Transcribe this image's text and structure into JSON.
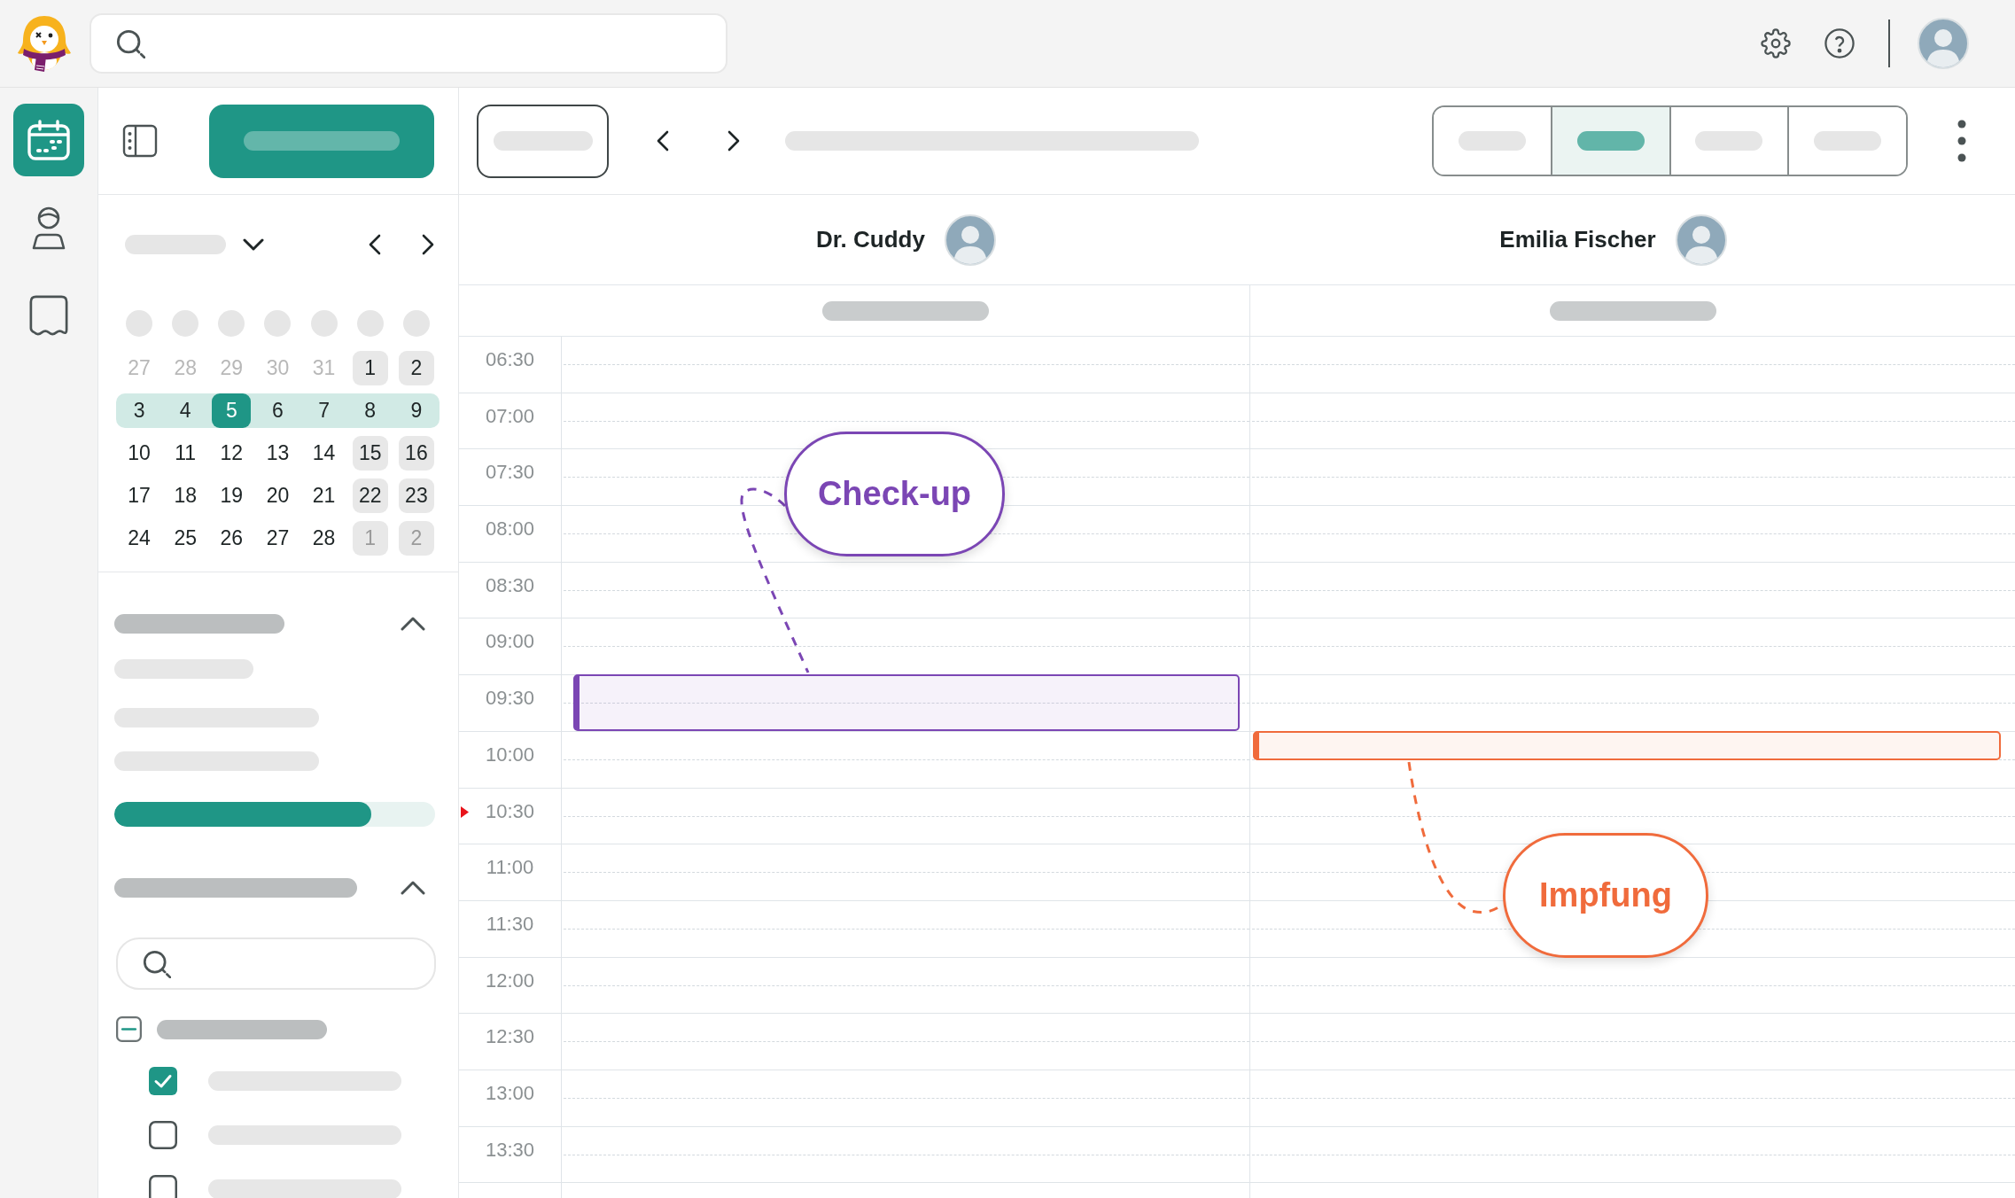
{
  "nav_rail": [
    {
      "selected": true
    },
    {
      "selected": false
    },
    {
      "selected": false
    }
  ],
  "mini_calendar": {
    "weeks": [
      {
        "selected": false,
        "days": [
          {
            "label": "27",
            "outside": true,
            "shaded": false,
            "selected": false
          },
          {
            "label": "28",
            "outside": true,
            "shaded": false,
            "selected": false
          },
          {
            "label": "29",
            "outside": true,
            "shaded": false,
            "selected": false
          },
          {
            "label": "30",
            "outside": true,
            "shaded": false,
            "selected": false
          },
          {
            "label": "31",
            "outside": true,
            "shaded": false,
            "selected": false
          },
          {
            "label": "1",
            "outside": false,
            "shaded": true,
            "selected": false
          },
          {
            "label": "2",
            "outside": false,
            "shaded": true,
            "selected": false
          }
        ]
      },
      {
        "selected": true,
        "days": [
          {
            "label": "3",
            "outside": false,
            "shaded": false,
            "selected": false
          },
          {
            "label": "4",
            "outside": false,
            "shaded": false,
            "selected": false
          },
          {
            "label": "5",
            "outside": false,
            "shaded": false,
            "selected": true
          },
          {
            "label": "6",
            "outside": false,
            "shaded": false,
            "selected": false
          },
          {
            "label": "7",
            "outside": false,
            "shaded": false,
            "selected": false
          },
          {
            "label": "8",
            "outside": false,
            "shaded": false,
            "selected": false
          },
          {
            "label": "9",
            "outside": false,
            "shaded": false,
            "selected": false
          }
        ]
      },
      {
        "selected": false,
        "days": [
          {
            "label": "10",
            "outside": false,
            "shaded": false,
            "selected": false
          },
          {
            "label": "11",
            "outside": false,
            "shaded": false,
            "selected": false
          },
          {
            "label": "12",
            "outside": false,
            "shaded": false,
            "selected": false
          },
          {
            "label": "13",
            "outside": false,
            "shaded": false,
            "selected": false
          },
          {
            "label": "14",
            "outside": false,
            "shaded": false,
            "selected": false
          },
          {
            "label": "15",
            "outside": false,
            "shaded": true,
            "selected": false
          },
          {
            "label": "16",
            "outside": false,
            "shaded": true,
            "selected": false
          }
        ]
      },
      {
        "selected": false,
        "days": [
          {
            "label": "17",
            "outside": false,
            "shaded": false,
            "selected": false
          },
          {
            "label": "18",
            "outside": false,
            "shaded": false,
            "selected": false
          },
          {
            "label": "19",
            "outside": false,
            "shaded": false,
            "selected": false
          },
          {
            "label": "20",
            "outside": false,
            "shaded": false,
            "selected": false
          },
          {
            "label": "21",
            "outside": false,
            "shaded": false,
            "selected": false
          },
          {
            "label": "22",
            "outside": false,
            "shaded": true,
            "selected": false
          },
          {
            "label": "23",
            "outside": false,
            "shaded": true,
            "selected": false
          }
        ]
      },
      {
        "selected": false,
        "days": [
          {
            "label": "24",
            "outside": false,
            "shaded": false,
            "selected": false
          },
          {
            "label": "25",
            "outside": false,
            "shaded": false,
            "selected": false
          },
          {
            "label": "26",
            "outside": false,
            "shaded": false,
            "selected": false
          },
          {
            "label": "27",
            "outside": false,
            "shaded": false,
            "selected": false
          },
          {
            "label": "28",
            "outside": false,
            "shaded": false,
            "selected": false
          },
          {
            "label": "1",
            "outside": true,
            "shaded": true,
            "selected": false
          },
          {
            "label": "2",
            "outside": true,
            "shaded": true,
            "selected": false
          }
        ]
      }
    ]
  },
  "sidebar_sections": [
    {
      "expanded": true,
      "progress": {
        "level": 0.8
      }
    },
    {
      "expanded": true,
      "filters": [
        {
          "checked": false,
          "indeterminate": true,
          "children": [
            {
              "checked": true
            },
            {
              "checked": false
            },
            {
              "checked": false
            }
          ]
        }
      ]
    }
  ],
  "view_switcher": [
    {
      "selected": false
    },
    {
      "selected": true
    },
    {
      "selected": false
    },
    {
      "selected": false
    }
  ],
  "resources": [
    {
      "name": "Dr. Cuddy",
      "events": [
        {
          "color": "#7b46b4",
          "callout": "Check-up"
        }
      ]
    },
    {
      "name": "Emilia Fischer",
      "events": [
        {
          "color": "#f06b3c",
          "callout": "Impfung"
        }
      ]
    }
  ],
  "time_slots": [
    {
      "label": "06:30",
      "current": false
    },
    {
      "label": "07:00",
      "current": false
    },
    {
      "label": "07:30",
      "current": false
    },
    {
      "label": "08:00",
      "current": false
    },
    {
      "label": "08:30",
      "current": false
    },
    {
      "label": "09:00",
      "current": false
    },
    {
      "label": "09:30",
      "current": false
    },
    {
      "label": "10:00",
      "current": false
    },
    {
      "label": "10:30",
      "current": true
    },
    {
      "label": "11:00",
      "current": false
    },
    {
      "label": "11:30",
      "current": false
    },
    {
      "label": "12:00",
      "current": false
    },
    {
      "label": "12:30",
      "current": false
    },
    {
      "label": "13:00",
      "current": false
    },
    {
      "label": "13:30",
      "current": false
    }
  ]
}
